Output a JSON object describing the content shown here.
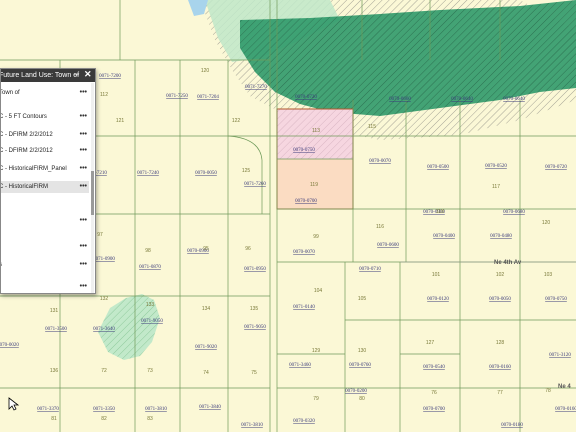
{
  "panel": {
    "title": "Future Land Use: Town of",
    "close_icon": "close-icon",
    "collapse_icon": "collapse-icon",
    "layers": [
      {
        "label": "Town of",
        "selected": false
      },
      {
        "label": "C - 5 FT Contours",
        "selected": false
      },
      {
        "label": "C - DFIRM 2/2/2012",
        "selected": false
      },
      {
        "label": "C - DFIRM 2/2/2012",
        "selected": false
      },
      {
        "label": "C - HistoricalFIRM_Panel",
        "selected": false
      },
      {
        "label": "C - HistoricalFIRM",
        "selected": true
      },
      {
        "label": "",
        "selected": false
      },
      {
        "label": "",
        "selected": false
      },
      {
        "label": "s",
        "selected": false
      },
      {
        "label": "",
        "selected": false
      }
    ]
  },
  "colors": {
    "parcel_fill": "#fbf8d6",
    "parcel_line": "#6f9a5a",
    "floodway_green": "#2f9a6a",
    "flood_zone_light": "#bfe8c9",
    "selected_parcel_pink": "#f6d6e0",
    "selected_parcel_peach": "#fbdcc2",
    "selection_outline": "#b0582a"
  },
  "map": {
    "parcels": [
      {
        "id": "p1",
        "label": "0071-7200"
      },
      {
        "id": "p2",
        "label": "0071-7250"
      },
      {
        "id": "p3",
        "label": "0071-7204"
      },
      {
        "id": "p4",
        "label": "0071-7270"
      },
      {
        "id": "p5",
        "label": "0070-0720"
      },
      {
        "id": "p6",
        "label": "0070-0660"
      },
      {
        "id": "p7",
        "label": "0070-0640"
      },
      {
        "id": "p8",
        "label": "0070-0640"
      },
      {
        "id": "p9",
        "label": "0070-0750"
      },
      {
        "id": "p10",
        "label": "0070-0070"
      },
      {
        "id": "p11",
        "label": "0070-0500"
      },
      {
        "id": "p12",
        "label": "0070-0520"
      },
      {
        "id": "p13",
        "label": "0070-0720"
      },
      {
        "id": "p14",
        "label": "0070-0700"
      },
      {
        "id": "p15",
        "label": "0071-7210"
      },
      {
        "id": "p16",
        "label": "0071-7240"
      },
      {
        "id": "p17",
        "label": "0070-0050"
      },
      {
        "id": "p18",
        "label": "0071-7260"
      },
      {
        "id": "p19",
        "label": "0070-0900"
      },
      {
        "id": "p20",
        "label": "0070-0680"
      },
      {
        "id": "p21",
        "label": "0070-0400"
      },
      {
        "id": "p22",
        "label": "0070-0480"
      },
      {
        "id": "p23",
        "label": "0070-0600"
      },
      {
        "id": "p24",
        "label": "0070-0070"
      },
      {
        "id": "p25",
        "label": "0071-0900"
      },
      {
        "id": "p26",
        "label": "0071-0870"
      },
      {
        "id": "p27",
        "label": "0070-0900"
      },
      {
        "id": "p28",
        "label": "0071-0950"
      },
      {
        "id": "p29",
        "label": "0070-0710"
      },
      {
        "id": "p30",
        "label": "0070-0120"
      },
      {
        "id": "p31",
        "label": "0070-0050"
      },
      {
        "id": "p32",
        "label": "0071-0140"
      },
      {
        "id": "p33",
        "label": "0070-0760"
      },
      {
        "id": "p34",
        "label": "0070-0540"
      },
      {
        "id": "p35",
        "label": "0070-0160"
      },
      {
        "id": "p36",
        "label": "0071-3460"
      },
      {
        "id": "p37",
        "label": "0071-3500"
      },
      {
        "id": "p38",
        "label": "0071-3640"
      },
      {
        "id": "p39",
        "label": "0071-9050"
      },
      {
        "id": "p40",
        "label": "0071-9020"
      },
      {
        "id": "p41",
        "label": "0071-9050"
      },
      {
        "id": "p42",
        "label": "0070-0020"
      },
      {
        "id": "p43",
        "label": "0070-0700"
      },
      {
        "id": "p44",
        "label": "0070-0320"
      },
      {
        "id": "p45",
        "label": "0070-0200"
      },
      {
        "id": "p46",
        "label": "0070-0750"
      },
      {
        "id": "p47",
        "label": "0071-3120"
      },
      {
        "id": "p48",
        "label": "0071-3370"
      },
      {
        "id": "p49",
        "label": "0071-3350"
      },
      {
        "id": "p50",
        "label": "0071-3810"
      },
      {
        "id": "p51",
        "label": "0071-3840"
      },
      {
        "id": "p52",
        "label": "0071-3810"
      },
      {
        "id": "p53",
        "label": "0070-0180"
      },
      {
        "id": "p54",
        "label": "0070-0160"
      }
    ],
    "lot_numbers": [
      "120",
      "112",
      "121",
      "122",
      "113",
      "115",
      "125",
      "119",
      "116",
      "118",
      "117",
      "120",
      "97",
      "98",
      "95",
      "96",
      "99",
      "101",
      "102",
      "103",
      "104",
      "105",
      "127",
      "128",
      "129",
      "130",
      "131",
      "132",
      "133",
      "134",
      "135",
      "136",
      "72",
      "73",
      "74",
      "75",
      "76",
      "77",
      "78",
      "79",
      "80",
      "81",
      "82",
      "83"
    ],
    "roads": [
      {
        "id": "r1",
        "label": "Ne 4th Av"
      },
      {
        "id": "r2",
        "label": "Ne 4"
      }
    ]
  }
}
